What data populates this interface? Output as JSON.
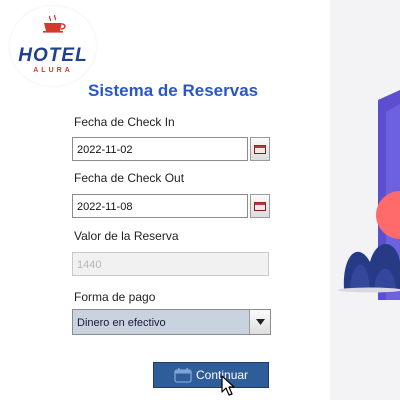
{
  "logo": {
    "brand": "HOTEL",
    "sub": "ALURA"
  },
  "form": {
    "title": "Sistema de Reservas",
    "checkin": {
      "label": "Fecha de Check In",
      "value": "2022-11-02",
      "icon": "calendar-icon"
    },
    "checkout": {
      "label": "Fecha de Check Out",
      "value": "2022-11-08",
      "icon": "calendar-icon"
    },
    "valor": {
      "label": "Valor de la Reserva",
      "value": "1440"
    },
    "pago": {
      "label": "Forma de pago",
      "selected": "Dinero en efectivo",
      "icon": "chevron-down-icon"
    },
    "continuar": {
      "label": "Continuar",
      "icon": "calendar-icon"
    }
  },
  "colors": {
    "title": "#2a56c6",
    "button": "#2f5d99",
    "select_bg": "#c9d3df",
    "logo_blue": "#1f3f8f",
    "logo_red": "#d33a2c"
  }
}
